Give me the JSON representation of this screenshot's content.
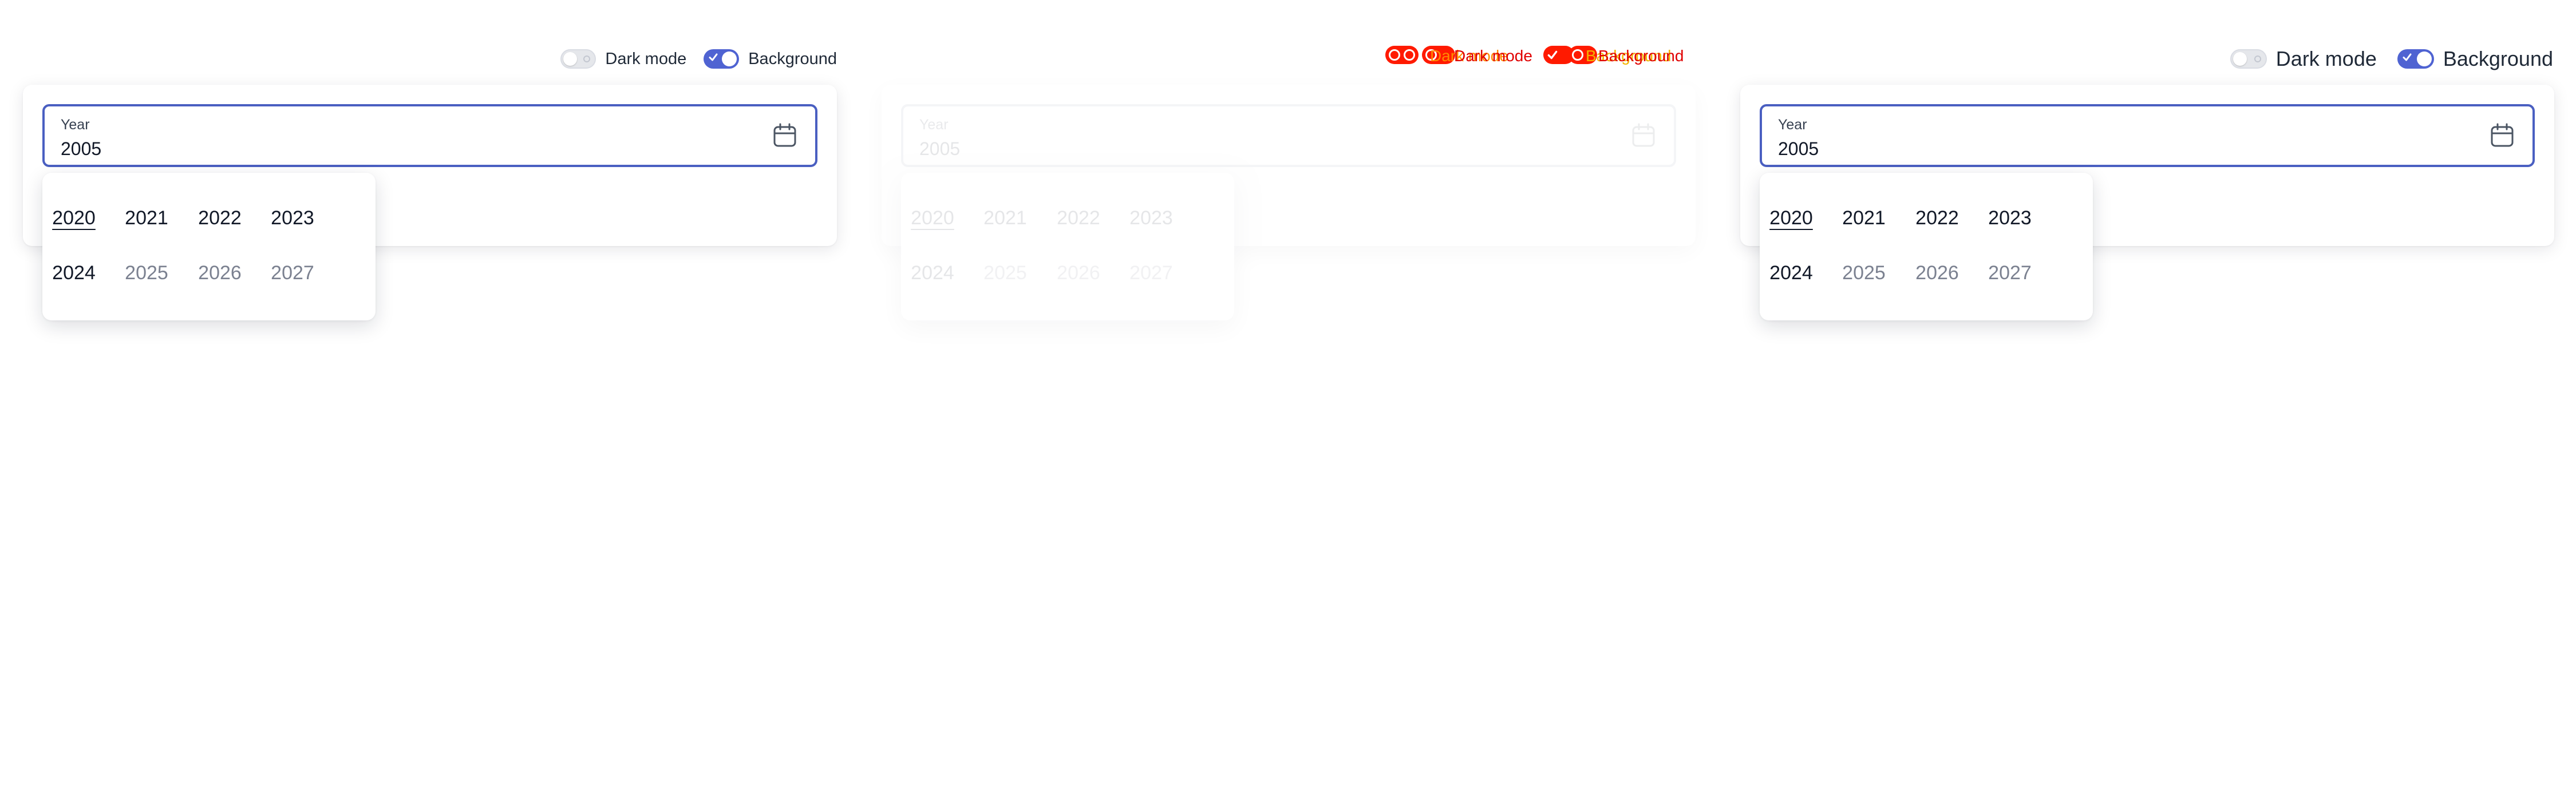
{
  "panels": [
    {
      "toggles": {
        "dark_mode_label": "Dark mode",
        "background_label": "Background"
      },
      "field": {
        "label": "Year",
        "value": "2005"
      },
      "years": [
        "2020",
        "2021",
        "2022",
        "2023",
        "2024",
        "2025",
        "2026",
        "2027"
      ]
    },
    {
      "toggles": {
        "dark_mode_label": "Dark mode",
        "background_label": "Background"
      },
      "field": {
        "label": "Year",
        "value": "2005"
      },
      "years": [
        "2020",
        "2021",
        "2022",
        "2023",
        "2024",
        "2025",
        "2026",
        "2027"
      ]
    },
    {
      "toggles": {
        "dark_mode_label": "Dark mode",
        "background_label": "Background"
      },
      "field": {
        "label": "Year",
        "value": "2005"
      },
      "years": [
        "2020",
        "2021",
        "2022",
        "2023",
        "2024",
        "2025",
        "2026",
        "2027"
      ]
    }
  ],
  "state": {
    "dark_mode_on": false,
    "background_on": true,
    "selected_year": "2020"
  },
  "icons": [
    "calendar-icon",
    "check-icon"
  ],
  "colors": {
    "accent": "#4f63d2",
    "field_border": "#4a5fc1",
    "muted_year": "#7b8190",
    "debug_red": "#ff1a00",
    "debug_orange": "#ff8a00"
  }
}
